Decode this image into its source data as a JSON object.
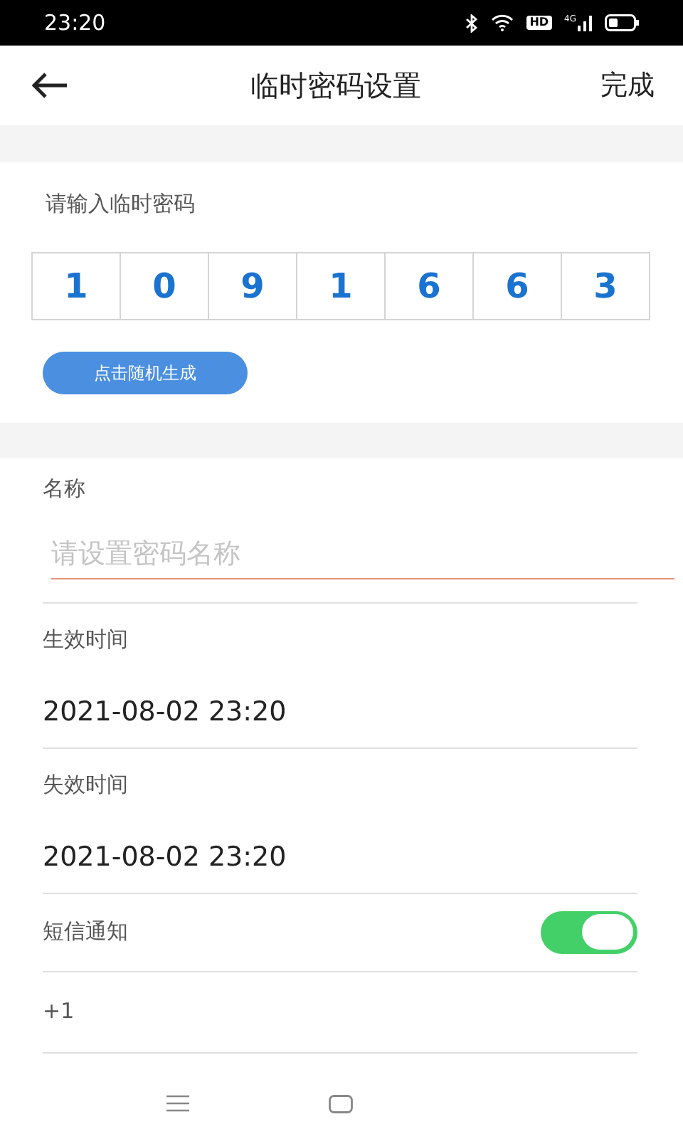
{
  "status_bar": {
    "time": "23:20",
    "hd": "HD",
    "network": "4G"
  },
  "header": {
    "title": "临时密码设置",
    "action": "完成"
  },
  "password": {
    "label": "请输入临时密码",
    "digits": [
      "1",
      "0",
      "9",
      "1",
      "6",
      "6",
      "3"
    ],
    "generate_button": "点击随机生成"
  },
  "name_field": {
    "label": "名称",
    "placeholder": "请设置密码名称"
  },
  "rows": [
    {
      "kind": "datetime",
      "label": "生效时间",
      "value": "2021-08-02 23:20"
    },
    {
      "kind": "datetime",
      "label": "失效时间",
      "value": "2021-08-02 23:20"
    },
    {
      "kind": "toggle",
      "label": "短信通知",
      "on": true
    },
    {
      "kind": "text",
      "label": "+1"
    }
  ]
}
